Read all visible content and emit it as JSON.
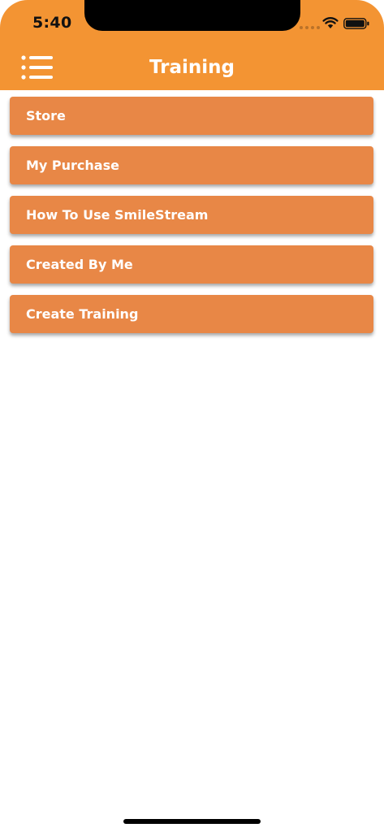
{
  "status_bar": {
    "time": "5:40"
  },
  "header": {
    "title": "Training",
    "menu_icon": "hamburger-list-icon"
  },
  "menu": {
    "items": [
      {
        "label": "Store"
      },
      {
        "label": "My Purchase"
      },
      {
        "label": "How To Use SmileStream"
      },
      {
        "label": "Created By Me"
      },
      {
        "label": "Create Training"
      }
    ]
  },
  "colors": {
    "header": "#F39433",
    "menu_item": "#E88746",
    "text_on_accent": "#FFFFFF"
  }
}
